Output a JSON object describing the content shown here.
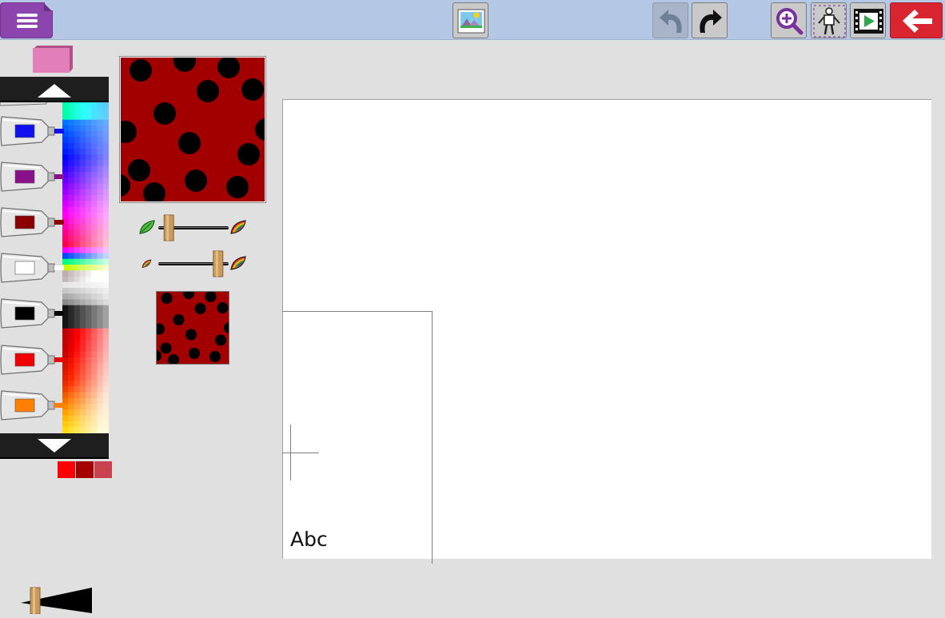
{
  "toolbar": {
    "menu_icon": "hamburger-menu-icon",
    "picture_icon": "landscape-picture-icon",
    "undo_icon": "undo-arrow-icon",
    "redo_icon": "redo-arrow-icon",
    "zoom_icon": "zoom-in-icon",
    "puppet_icon": "puppet-figure-icon",
    "film_icon": "film-play-icon",
    "back_icon": "back-arrow-icon",
    "undo_enabled": false
  },
  "tools": {
    "eraser_icon": "eraser-icon",
    "eraser_color": "#e37fb8"
  },
  "palette": {
    "scroll_up_icon": "triangle-up-icon",
    "scroll_down_icon": "triangle-down-icon",
    "tubes": [
      {
        "name": "blue",
        "color": "#1010ee"
      },
      {
        "name": "purple",
        "color": "#8a0f8a"
      },
      {
        "name": "dark-red",
        "color": "#8b0000"
      },
      {
        "name": "white",
        "color": "#ffffff"
      },
      {
        "name": "black",
        "color": "#000000"
      },
      {
        "name": "red",
        "color": "#f00000"
      },
      {
        "name": "orange",
        "color": "#ff7f00"
      }
    ],
    "recent_colors": [
      "#ff0000",
      "#a50000",
      "#c8434f"
    ]
  },
  "texture": {
    "base_color": "#a20000",
    "dot_color": "#000000",
    "slider_1_value": 0.15,
    "slider_2_value": 0.85,
    "slider_1_left_icon": "leaf-icon",
    "slider_1_right_icon": "rainbow-leaf-icon",
    "slider_2_left_icon": "small-rainbow-leaf-icon",
    "slider_2_right_icon": "rainbow-leaf-icon"
  },
  "canvas": {
    "text_sample": "Abc",
    "background": "#ffffff"
  },
  "brush": {
    "icon": "brush-size-wedge-icon",
    "value": 0.15
  }
}
